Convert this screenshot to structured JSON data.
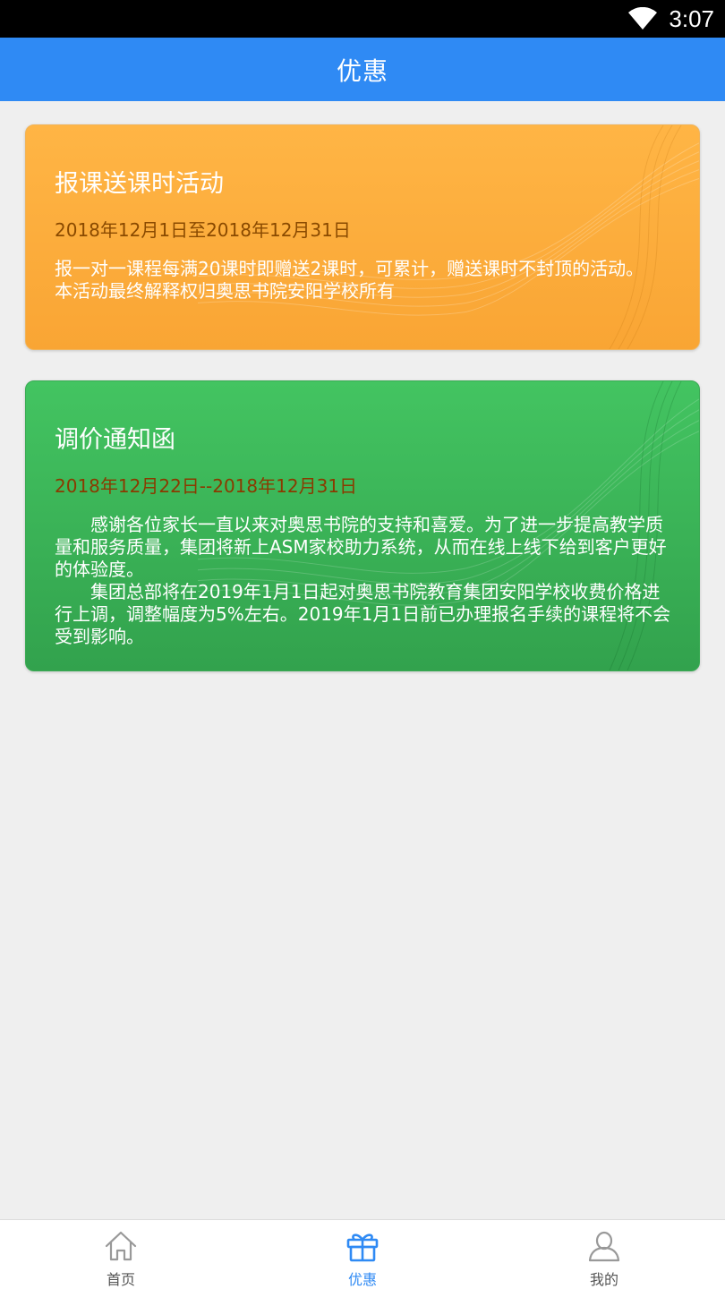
{
  "status_bar": {
    "time": "3:07",
    "icons": [
      "wifi-icon"
    ]
  },
  "app_bar": {
    "title": "优惠"
  },
  "cards": [
    {
      "title": "报课送课时活动",
      "date": "2018年12月1日至2018年12月31日",
      "body": [
        "报一对一课程每满20课时即赠送2课时，可累计，赠送课时不封顶的活动。",
        "本活动最终解释权归奥思书院安阳学校所有"
      ],
      "color": "#f9a534"
    },
    {
      "title": "调价通知函",
      "date": "2018年12月22日--2018年12月31日",
      "body": [
        "感谢各位家长一直以来对奥思书院的支持和喜爱。为了进一步提高教学质量和服务质量，集团将新上ASM家校助力系统，从而在线上线下给到客户更好的体验度。",
        "集团总部将在2019年1月1日起对奥思书院教育集团安阳学校收费价格进行上调，调整幅度为5%左右。2019年1月1日前已办理报名手续的课程将不会受到影响。"
      ],
      "color": "#3aae52"
    }
  ],
  "tab_bar": {
    "tabs": [
      {
        "label": "首页",
        "icon": "home-icon",
        "active": false
      },
      {
        "label": "优惠",
        "icon": "gift-icon",
        "active": true
      },
      {
        "label": "我的",
        "icon": "user-icon",
        "active": false
      }
    ]
  },
  "colors": {
    "primary": "#2f8af4",
    "background": "#efefef"
  }
}
